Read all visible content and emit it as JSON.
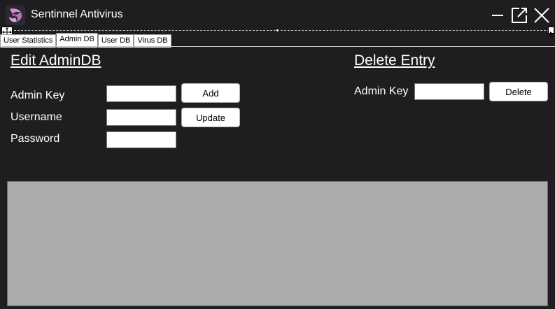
{
  "app": {
    "title": "Sentinnel Antivirus",
    "icon": "swirl-logo-icon",
    "accent": "#c77bc4"
  },
  "window_controls": {
    "minimize_icon": "minimize-icon",
    "popout_icon": "popout-icon",
    "close_icon": "close-icon"
  },
  "tabs": [
    {
      "label": "User Statistics",
      "active": false
    },
    {
      "label": "Admin DB",
      "active": true
    },
    {
      "label": "User DB",
      "active": false
    },
    {
      "label": "Virus DB",
      "active": false
    }
  ],
  "edit_section": {
    "heading": "Edit AdminDB",
    "admin_key_label": "Admin Key",
    "username_label": "Username",
    "password_label": "Password",
    "admin_key_value": "",
    "username_value": "",
    "password_value": "",
    "add_label": "Add",
    "update_label": "Update"
  },
  "delete_section": {
    "heading": "Delete Entry",
    "admin_key_label": "Admin Key",
    "admin_key_value": "",
    "delete_label": "Delete"
  },
  "colors": {
    "background": "#1e1e21",
    "grid_background": "#ababab"
  }
}
